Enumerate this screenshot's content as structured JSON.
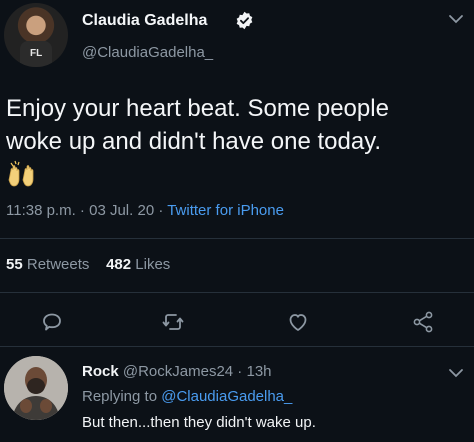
{
  "tweet": {
    "display_name": "Claudia Gadelha",
    "handle": "@ClaudiaGadelha_",
    "avatar_shirt_text": "FL",
    "text_line1": "Enjoy your heart beat. Some people",
    "text_line2": "woke up and didn't have one today.",
    "emoji": "raised-hands-emoji",
    "time": "11:38 p.m.",
    "sep1": " · ",
    "date": "03 Jul. 20",
    "sep2": " · ",
    "client": "Twitter for iPhone",
    "retweets_count": "55",
    "retweets_label": "Retweets",
    "likes_count": "482",
    "likes_label": "Likes"
  },
  "actions": [
    "reply-icon",
    "retweet-icon",
    "like-icon",
    "share-icon"
  ],
  "reply": {
    "display_name": "Rock",
    "handle": "@RockJames24",
    "sep": " · ",
    "age": "13h",
    "replying_prefix": "Replying to ",
    "replying_handle": "@ClaudiaGadelha_",
    "text": "But then...then they didn't wake up."
  },
  "colors": {
    "background": "#0c1117",
    "link": "#4a9cf0",
    "muted": "#8d98a3",
    "divider": "#26303a"
  }
}
